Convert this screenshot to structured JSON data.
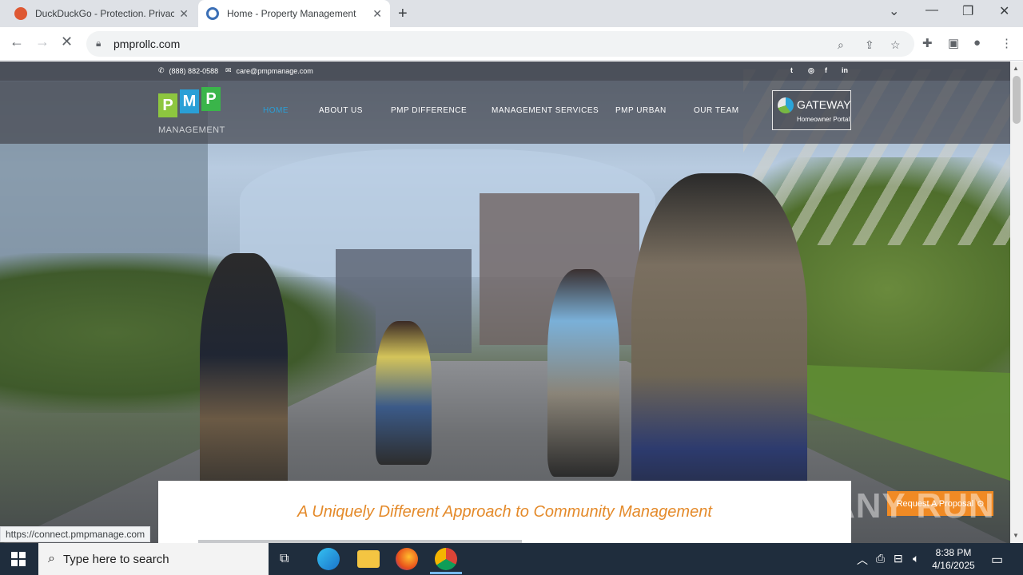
{
  "browser": {
    "tabs": [
      {
        "title": "DuckDuckGo - Protection. Privacy",
        "favicon_color": "#de5833"
      },
      {
        "title": "Home - Property Management",
        "favicon_color": "#3b6fb6"
      }
    ],
    "url": "pmprollc.com",
    "status_url": "https://connect.pmpmanage.com"
  },
  "site": {
    "contact": {
      "phone": "(888) 882-0588",
      "email": "care@pmpmanage.com"
    },
    "social": [
      "twitter-icon",
      "instagram-icon",
      "facebook-icon",
      "linkedin-icon"
    ],
    "logo": {
      "letters": [
        "P",
        "M",
        "P"
      ],
      "tile_colors": [
        "#8dc63f",
        "#2a9fd6",
        "#3ab54a"
      ],
      "word": "MANAGEMENT"
    },
    "nav": [
      {
        "label": "HOME",
        "active": true
      },
      {
        "label": "ABOUT US",
        "active": false
      },
      {
        "label": "PMP DIFFERENCE",
        "active": false
      },
      {
        "label": "MANAGEMENT SERVICES",
        "active": false
      },
      {
        "label": "PMP URBAN",
        "active": false
      },
      {
        "label": "OUR TEAM",
        "active": false
      }
    ],
    "gateway": {
      "name": "GATEWAY",
      "subtitle": "Homeowner Portal"
    },
    "tagline": "A Uniquely Different Approach to Community Management",
    "tagline_color": "#e48a2a",
    "proposal_button": "Request A Proposal",
    "accent": "#2a9fd6"
  },
  "watermark": "ANY RUN",
  "taskbar": {
    "search_placeholder": "Type here to search",
    "time": "8:38 PM",
    "date": "4/16/2025"
  }
}
